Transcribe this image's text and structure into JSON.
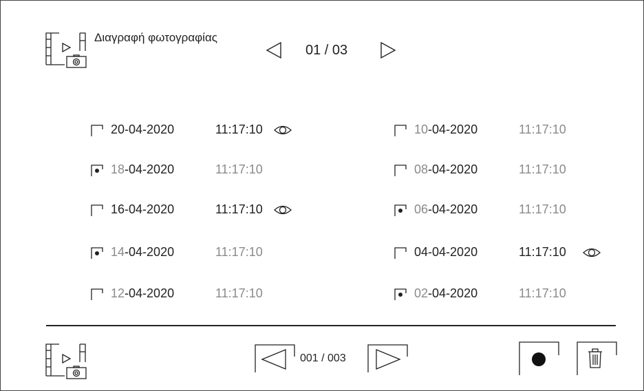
{
  "header": {
    "icon": "media-camera-icon",
    "title": "Διαγραφή φωτογραφίας",
    "page_counter": "01 / 03",
    "prev_icon": "triangle-left-icon",
    "next_icon": "triangle-right-icon"
  },
  "records": [
    {
      "checked": false,
      "day": "20",
      "date_rest": "-04-2020",
      "time": "11:17:10",
      "viewed": true,
      "highlighted": true
    },
    {
      "checked": true,
      "day": "18",
      "date_rest": "-04-2020",
      "time": "11:17:10",
      "viewed": false,
      "highlighted": false
    },
    {
      "checked": false,
      "day": "16",
      "date_rest": "-04-2020",
      "time": "11:17:10",
      "viewed": true,
      "highlighted": true
    },
    {
      "checked": true,
      "day": "14",
      "date_rest": "-04-2020",
      "time": "11:17:10",
      "viewed": false,
      "highlighted": false
    },
    {
      "checked": false,
      "day": "12",
      "date_rest": "-04-2020",
      "time": "11:17:10",
      "viewed": false,
      "highlighted": false
    },
    {
      "checked": false,
      "day": "10",
      "date_rest": "-04-2020",
      "time": "11:17:10",
      "viewed": false,
      "highlighted": false
    },
    {
      "checked": false,
      "day": "08",
      "date_rest": "-04-2020",
      "time": "11:17:10",
      "viewed": false,
      "highlighted": false
    },
    {
      "checked": true,
      "day": "06",
      "date_rest": "-04-2020",
      "time": "11:17:10",
      "viewed": false,
      "highlighted": false
    },
    {
      "checked": false,
      "day": "04",
      "date_rest": "-04-2020",
      "time": "11:17:10",
      "viewed": true,
      "highlighted": true
    },
    {
      "checked": true,
      "day": "02",
      "date_rest": "-04-2020",
      "time": "11:17:10",
      "viewed": false,
      "highlighted": false
    }
  ],
  "footer": {
    "icon": "media-camera-icon",
    "counter": "001 / 003",
    "prev_icon": "triangle-left-icon",
    "next_icon": "triangle-right-icon",
    "record_icon": "record-dot-icon",
    "delete_icon": "trash-icon"
  },
  "colors": {
    "text": "#222222",
    "faded": "#8a8a8a",
    "background": "#ffffff"
  }
}
